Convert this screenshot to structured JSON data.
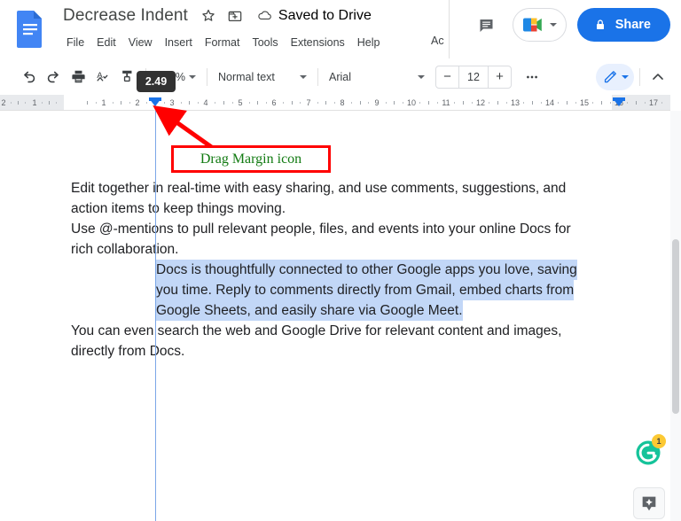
{
  "app": {
    "name": "Google Docs",
    "logo_icon": "docs-file-icon"
  },
  "header": {
    "doc_title": "Decrease Indent",
    "star_icon": "star-icon",
    "move_icon": "move-to-folder-icon",
    "cloud_icon": "cloud-saved-icon",
    "save_status": "Saved to Drive",
    "menus": [
      "File",
      "Edit",
      "View",
      "Insert",
      "Format",
      "Tools",
      "Extensions",
      "Help"
    ],
    "menu_clipped": "Ac",
    "comment_icon": "comment-icon",
    "meet_icon": "google-meet-icon",
    "meet_caret_icon": "chevron-down-icon",
    "share_label": "Share",
    "share_lock_icon": "lock-icon"
  },
  "toolbar": {
    "undo_icon": "undo-icon",
    "redo_icon": "redo-icon",
    "print_icon": "print-icon",
    "spellcheck_icon": "spellcheck-icon",
    "paint_format_icon": "paint-format-icon",
    "zoom_value": "100%",
    "paragraph_style": "Normal text",
    "font_family": "Arial",
    "font_size": "12",
    "decrease_font_label": "−",
    "increase_font_label": "+",
    "more_label": "•••",
    "edit_mode_icon": "pencil-icon",
    "edit_mode_caret_icon": "chevron-down-icon",
    "collapse_icon": "chevron-up-icon"
  },
  "ruler": {
    "left_numbers": [
      "2",
      "1"
    ],
    "numbers": [
      "1",
      "2",
      "3",
      "4",
      "5",
      "6",
      "7",
      "8",
      "9",
      "10",
      "11",
      "12",
      "13",
      "14",
      "15",
      "16",
      "17"
    ],
    "left_indent_marker": "left-indent-marker",
    "right_indent_marker": "right-indent-marker",
    "drag_tooltip_value": "2.49"
  },
  "annotation": {
    "label": "Drag Margin icon",
    "box_border_color": "#ff0000",
    "text_color": "#117a11",
    "arrow_color": "#ff0000",
    "arrow_icon": "red-arrow-icon"
  },
  "document": {
    "paragraphs": [
      {
        "id": "p1",
        "lines": [
          "Edit together in real-time with easy sharing, and use comments, suggestions, and",
          "action items to keep things moving."
        ],
        "selected": false,
        "indented": false
      },
      {
        "id": "p2",
        "lines": [
          "Use @-mentions to pull relevant people, files, and events into your online Docs for",
          "rich collaboration."
        ],
        "selected": false,
        "indented": false
      },
      {
        "id": "p3",
        "lines": [
          "Docs is thoughtfully connected to other Google apps you love, saving",
          "you time. Reply to comments directly from Gmail, embed charts from",
          "Google Sheets, and easily share via Google Meet."
        ],
        "selected": true,
        "indented": true
      },
      {
        "id": "p4",
        "lines": [
          "You can even search the web and Google Drive for relevant content and images,",
          "directly from Docs."
        ],
        "selected": false,
        "indented": false
      }
    ],
    "selection_color": "#c2d7f7",
    "indent_guide_color": "#7ba7e8"
  },
  "floating": {
    "grammarly_icon": "grammarly-icon",
    "grammarly_badge_count": "1",
    "ai_assist_icon": "sparkle-icon"
  },
  "scrollbar": {
    "vertical_thumb": "vertical-scroll-thumb"
  },
  "colors": {
    "brand_blue": "#1a73e8",
    "selection": "#c2d7f7",
    "tooltip_bg": "#323232",
    "annotation_red": "#ff0000",
    "annotation_green": "#117a11"
  }
}
